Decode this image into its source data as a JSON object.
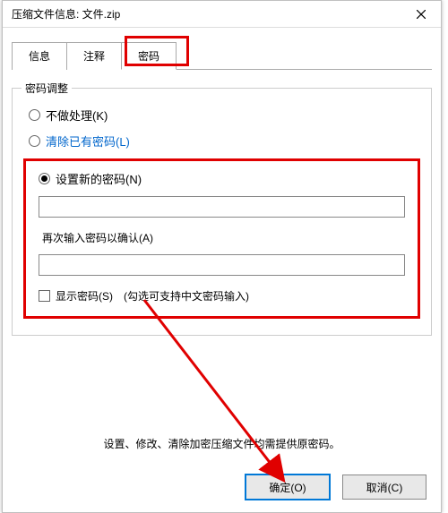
{
  "titlebar": {
    "text": "压缩文件信息: 文件.zip"
  },
  "tabs": {
    "info": "信息",
    "comment": "注释",
    "password": "密码"
  },
  "group": {
    "title": "密码调整",
    "radio_none": "不做处理(K)",
    "radio_clear": "清除已有密码(L)",
    "radio_set": "设置新的密码(N)",
    "confirm_label": "再次输入密码以确认(A)",
    "show_pw": "显示密码(S)",
    "show_pw_hint": "(勾选可支持中文密码输入)"
  },
  "footer": "设置、修改、清除加密压缩文件均需提供原密码。",
  "buttons": {
    "ok": "确定(O)",
    "cancel": "取消(C)"
  }
}
